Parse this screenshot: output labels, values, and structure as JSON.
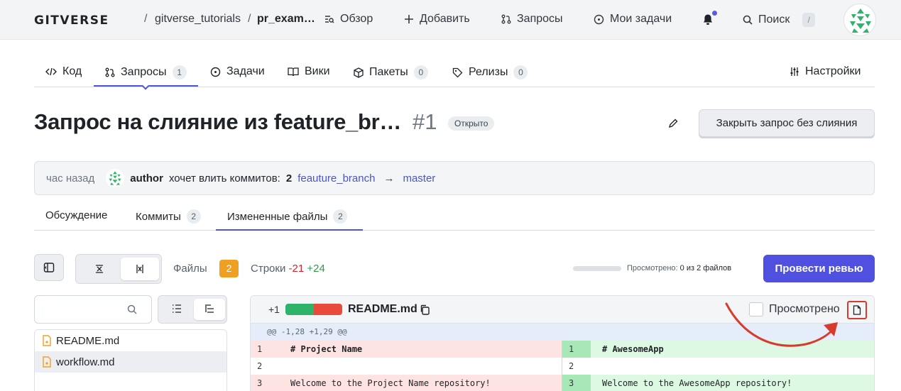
{
  "topbar": {
    "logo": "GITVERSE",
    "sep1": "/",
    "owner": "gitverse_tutorials",
    "sep2": "/",
    "repo": "pr_exam…",
    "nav": [
      {
        "label": "Обзор",
        "icon": "overview-icon"
      },
      {
        "label": "Добавить",
        "icon": "plus-icon"
      },
      {
        "label": "Запросы",
        "icon": "pull-request-icon"
      },
      {
        "label": "Мои задачи",
        "icon": "issue-icon"
      }
    ],
    "search_label": "Поиск",
    "search_shortcut": "/",
    "notification_dot_color": "#5b5be0"
  },
  "repo_tabs": [
    {
      "label": "Код",
      "icon": "code-icon",
      "count": null
    },
    {
      "label": "Запросы",
      "icon": "pull-request-icon",
      "count": "1"
    },
    {
      "label": "Задачи",
      "icon": "issue-icon",
      "count": null
    },
    {
      "label": "Вики",
      "icon": "book-icon",
      "count": null
    },
    {
      "label": "Пакеты",
      "icon": "package-icon",
      "count": "0"
    },
    {
      "label": "Релизы",
      "icon": "tag-icon",
      "count": "0"
    },
    {
      "label": "Настройки",
      "icon": "settings-icon",
      "count": null
    }
  ],
  "pr": {
    "title": "Запрос на слияние из feature_br…",
    "number": "#1",
    "status": "Открыто",
    "close_button": "Закрыть запрос без слияния"
  },
  "meta": {
    "time": "час назад",
    "author": "author",
    "wants_merge": "хочет влить коммитов:",
    "commit_count": "2",
    "source_branch": "feauture_branch",
    "arrow": "→",
    "target_branch": "master"
  },
  "pr_tabs": [
    {
      "label": "Обсуждение",
      "count": null
    },
    {
      "label": "Коммиты",
      "count": "2"
    },
    {
      "label": "Измененные файлы",
      "count": "2"
    }
  ],
  "toolbar": {
    "files_label": "Файлы",
    "files_count": "2",
    "lines_label": "Строки",
    "lines_removed": "-21",
    "lines_added": "+24",
    "viewed_label": "Просмотрено:",
    "viewed_value": "0 из 2 файлов",
    "review_button": "Провести ревью",
    "review_color": "#4f50df"
  },
  "file_tree": {
    "search_placeholder": "",
    "files": [
      {
        "name": "README.md",
        "selected": false
      },
      {
        "name": "workflow.md",
        "selected": true
      }
    ]
  },
  "diff": {
    "added_count": "+1",
    "filename": "README.md",
    "viewed_label": "Просмотрено",
    "hunk_header": "@@ -1,28 +1,29 @@",
    "rows": [
      {
        "left_num": "1",
        "left_text": "# Project Name",
        "left_type": "del",
        "right_num": "1",
        "right_text": "# AwesomeApp",
        "right_type": "add",
        "bold": true
      },
      {
        "left_num": "2",
        "left_text": "",
        "left_type": "ctx",
        "right_num": "2",
        "right_text": "",
        "right_type": "ctx",
        "bold": false
      },
      {
        "left_num": "3",
        "left_text": "Welcome to the Project Name repository!",
        "left_type": "del",
        "right_num": "3",
        "right_text": "Welcome to the AwesomeApp repository!",
        "right_type": "add",
        "bold": false
      }
    ]
  }
}
